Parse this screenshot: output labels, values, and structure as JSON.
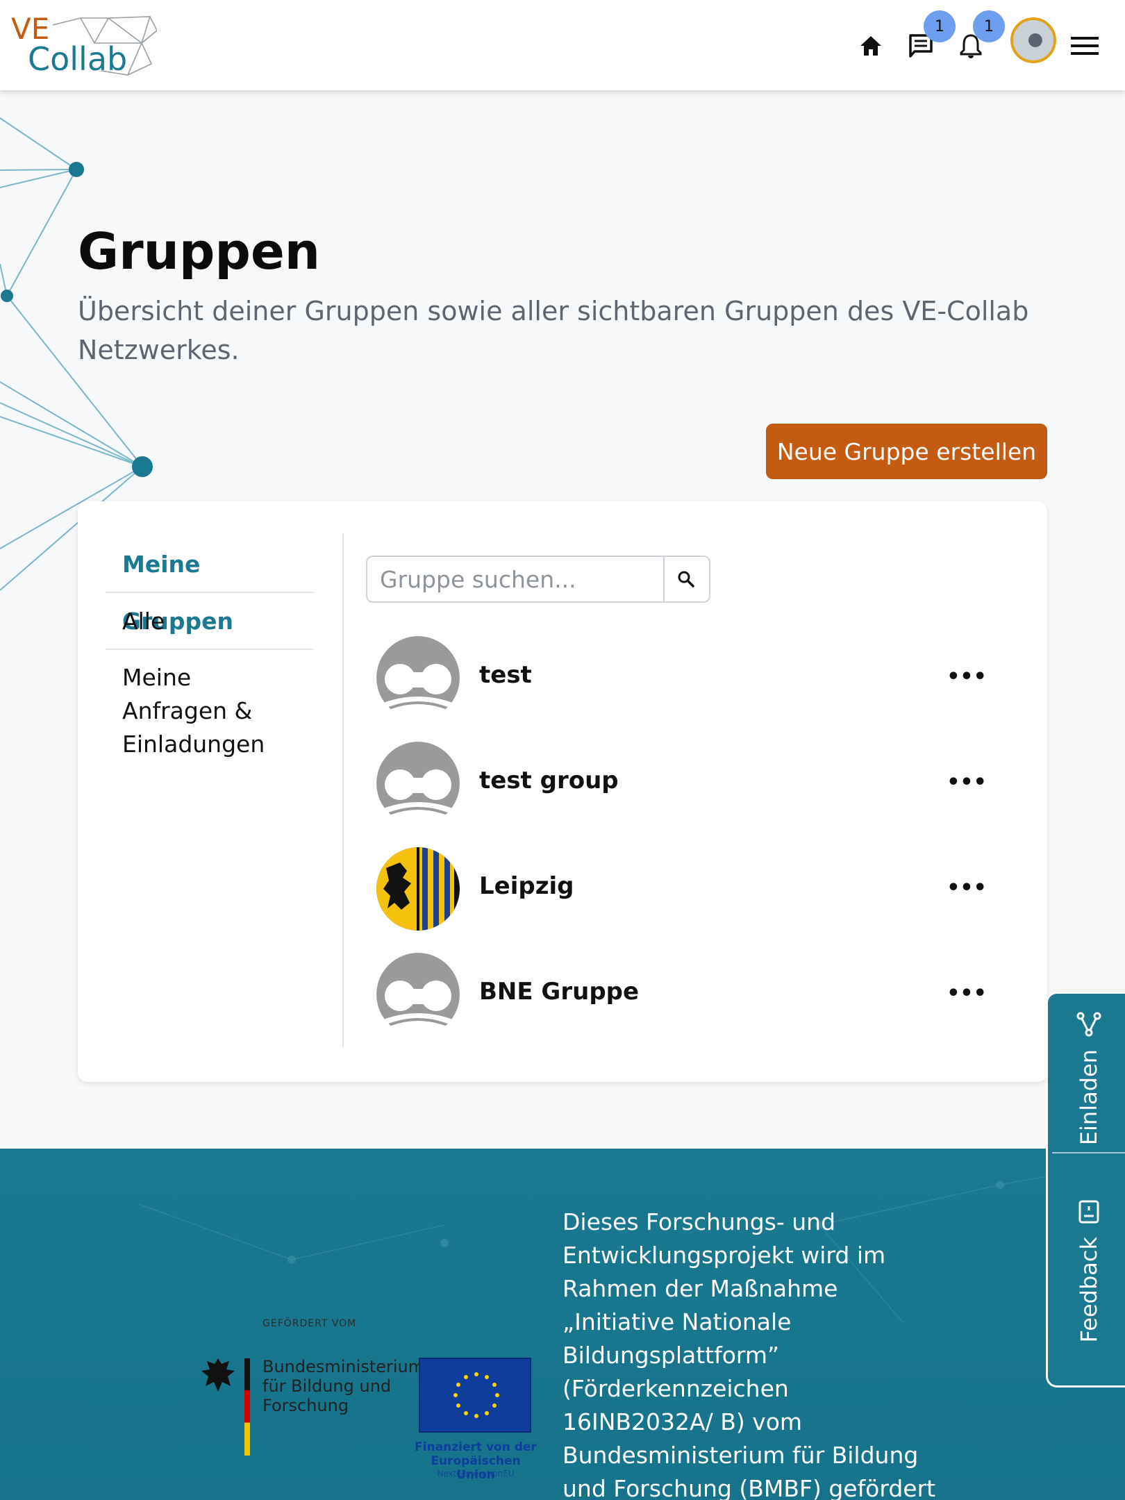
{
  "header": {
    "logo_ve": "VE",
    "logo_collab": "Collab",
    "messages_badge": "1",
    "notifications_badge": "1"
  },
  "page": {
    "title": "Gruppen",
    "subtitle": "Übersicht deiner Gruppen sowie aller sichtbaren Gruppen des VE-Collab Netzwerkes.",
    "new_group_button": "Neue Gruppe erstellen"
  },
  "sidenav": {
    "items": [
      {
        "label": "Meine Gruppen",
        "active": true
      },
      {
        "label": "Alle",
        "active": false
      },
      {
        "label": "Meine Anfragen & Einladungen",
        "active": false
      }
    ]
  },
  "search": {
    "placeholder": "Gruppe suchen...",
    "value": ""
  },
  "groups": [
    {
      "name": "test",
      "avatar": "default-avatar"
    },
    {
      "name": "test group",
      "avatar": "default-avatar"
    },
    {
      "name": "Leipzig",
      "avatar": "leipzig-coat-of-arms"
    },
    {
      "name": "BNE Gruppe",
      "avatar": "default-avatar"
    }
  ],
  "more_icon": "•••",
  "footer": {
    "gefoerdert": "GEFÖRDERT VOM",
    "bmbf_name": "Bundesministerium für Bildung und Forschung",
    "eu_text": "Finanziert von der Europäischen Union",
    "eu_sub": "NextGenerationEU",
    "funding_text": "Dieses Forschungs- und Entwicklungsprojekt wird im Rahmen der Maßnahme „Initiative Nationale Bildungsplattform” (Förderkennzeichen 16INB2032A/ B) vom Bundesministerium für Bildung und Forschung (BMBF) gefördert und vom Projektträger"
  },
  "sidetab": {
    "invite_label": "Einladen",
    "feedback_label": "Feedback"
  },
  "colors": {
    "accent_orange": "#c55a11",
    "teal": "#1b7a92",
    "badge_blue": "#6d9ef0"
  }
}
